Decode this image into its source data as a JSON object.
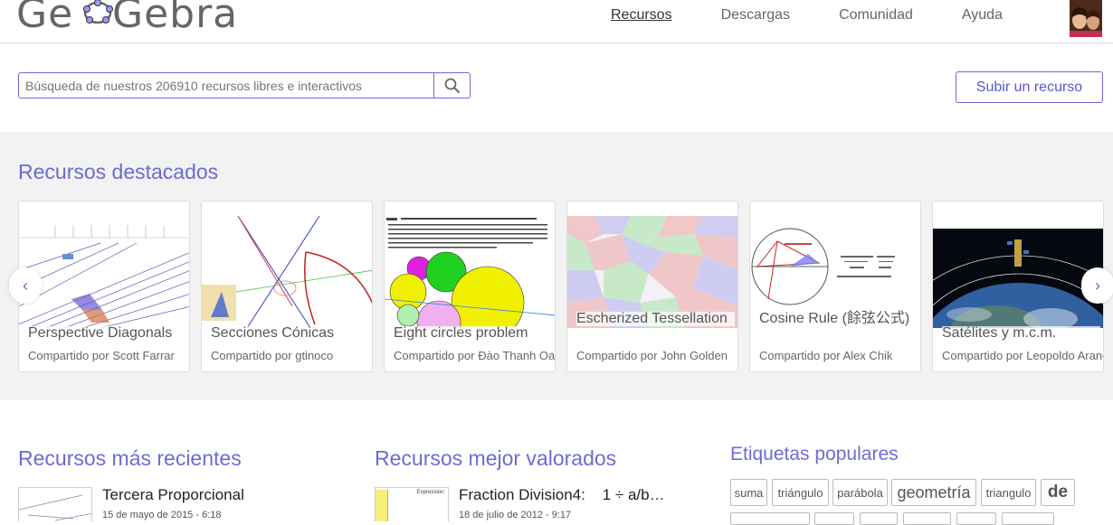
{
  "header": {
    "logo_text": "GeoGebra",
    "nav": [
      {
        "label": "Recursos",
        "active": true
      },
      {
        "label": "Descargas",
        "active": false
      },
      {
        "label": "Comunidad",
        "active": false
      },
      {
        "label": "Ayuda",
        "active": false
      }
    ]
  },
  "search": {
    "placeholder": "Búsqueda de nuestros 206910 recursos libres e interactivos",
    "value": ""
  },
  "upload_label": "Subir un recurso",
  "featured": {
    "title": "Recursos destacados",
    "cards": [
      {
        "title": "Perspective Diagonals",
        "by": "Compartido por Scott Farrar"
      },
      {
        "title": "Secciones Cónicas",
        "by": "Compartido por gtinoco"
      },
      {
        "title": "Eight circles problem",
        "by": "Compartido por Đào Thanh Oai"
      },
      {
        "title": "Escherized Tessellation",
        "by": "Compartido por John Golden"
      },
      {
        "title": "Cosine Rule (餘弦公式)",
        "by": "Compartido por Alex Chik"
      },
      {
        "title": "Satélites y m.c.m.",
        "by": "Compartido por Leopoldo Aranda"
      }
    ],
    "prev_icon": "‹",
    "next_icon": "›"
  },
  "recent": {
    "title": "Recursos más recientes",
    "items": [
      {
        "title": "Tercera Proporcional",
        "date": "15 de mayo de 2015 - 6:18"
      }
    ]
  },
  "top_rated": {
    "title": "Recursos mejor valorados",
    "items": [
      {
        "title": "Fraction Division4:    1 ÷ a/b…",
        "date": "18 de julio de 2012 - 9:17",
        "thumb_label": "Expression:"
      }
    ]
  },
  "tags": {
    "title": "Etiquetas populares",
    "items": [
      "suma",
      "triángulo",
      "parábola",
      "geometría",
      "triangulo",
      "de"
    ]
  },
  "colors": {
    "accent": "#6b6bd6",
    "band": "#f2f2f2"
  }
}
